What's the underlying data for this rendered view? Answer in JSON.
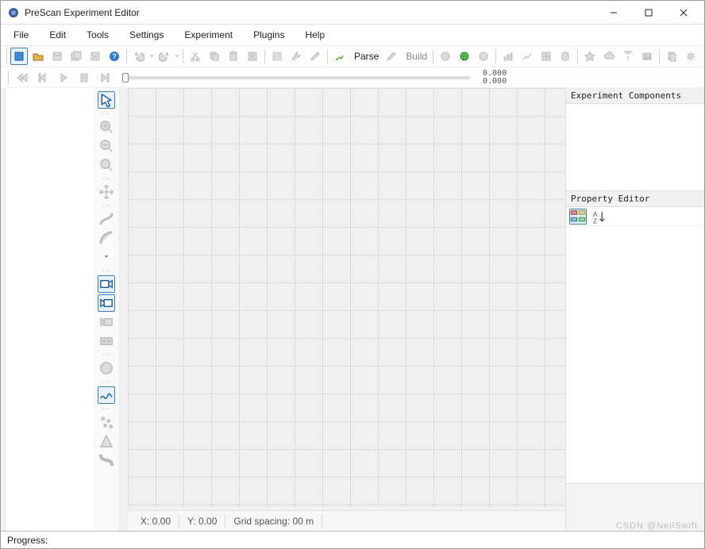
{
  "window": {
    "title": "PreScan Experiment Editor"
  },
  "menu": {
    "items": [
      "File",
      "Edit",
      "Tools",
      "Settings",
      "Experiment",
      "Plugins",
      "Help"
    ]
  },
  "toolbar": {
    "parse_label": "Parse",
    "build_label": "Build"
  },
  "playback": {
    "time_top": "0.000",
    "time_bottom": "0.000"
  },
  "canvas_status": {
    "x_label": "X: 0.00",
    "y_label": "Y: 0.00",
    "grid_label": "Grid spacing: 00 m"
  },
  "right_panels": {
    "components_title": "Experiment Components",
    "property_title": "Property Editor"
  },
  "statusbar": {
    "progress_label": "Progress:"
  },
  "watermark": "CSDN @NeilSwift"
}
